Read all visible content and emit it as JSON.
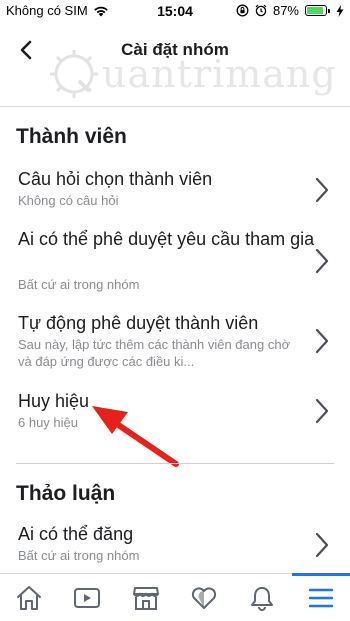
{
  "status": {
    "carrier": "Không có SIM",
    "time": "15:04",
    "battery": "87%",
    "battery_level": 0.87,
    "icons": [
      "wifi-icon",
      "rotation-lock-icon",
      "alarm-icon",
      "battery-icon",
      "charging-icon"
    ]
  },
  "nav": {
    "back_icon": "chevron-left-icon",
    "title": "Cài đặt nhóm"
  },
  "watermark": {
    "text": "uantrimang"
  },
  "sections": {
    "members": {
      "title": "Thành viên",
      "items": [
        {
          "title": "Câu hỏi chọn thành viên",
          "subtitle": "Không có câu hỏi"
        },
        {
          "title": "Ai có thể phê duyệt yêu cầu tham gia",
          "subtitle": "Bất cứ ai trong nhóm"
        },
        {
          "title": "Tự động phê duyệt thành viên",
          "subtitle": "Sau này, lập tức thêm các thành viên đang chờ và đáp ứng được các điều ki..."
        },
        {
          "title": "Huy hiệu",
          "subtitle": "6 huy hiệu"
        }
      ]
    },
    "discussion": {
      "title": "Thảo luận",
      "items": [
        {
          "title": "Ai có thể đăng",
          "subtitle": "Bất cứ ai trong nhóm"
        }
      ]
    }
  },
  "tab_bar": {
    "tabs": [
      {
        "name": "home",
        "icon": "home-icon"
      },
      {
        "name": "watch",
        "icon": "video-icon"
      },
      {
        "name": "marketplace",
        "icon": "store-icon"
      },
      {
        "name": "dating",
        "icon": "heart-icon"
      },
      {
        "name": "notifications",
        "icon": "bell-icon"
      },
      {
        "name": "menu",
        "icon": "menu-icon",
        "active": true
      }
    ]
  },
  "colors": {
    "accent": "#1877f2",
    "annotation_arrow": "#e8201c",
    "subtitle": "#8a8d91",
    "battery_fill": "#4cd964"
  }
}
